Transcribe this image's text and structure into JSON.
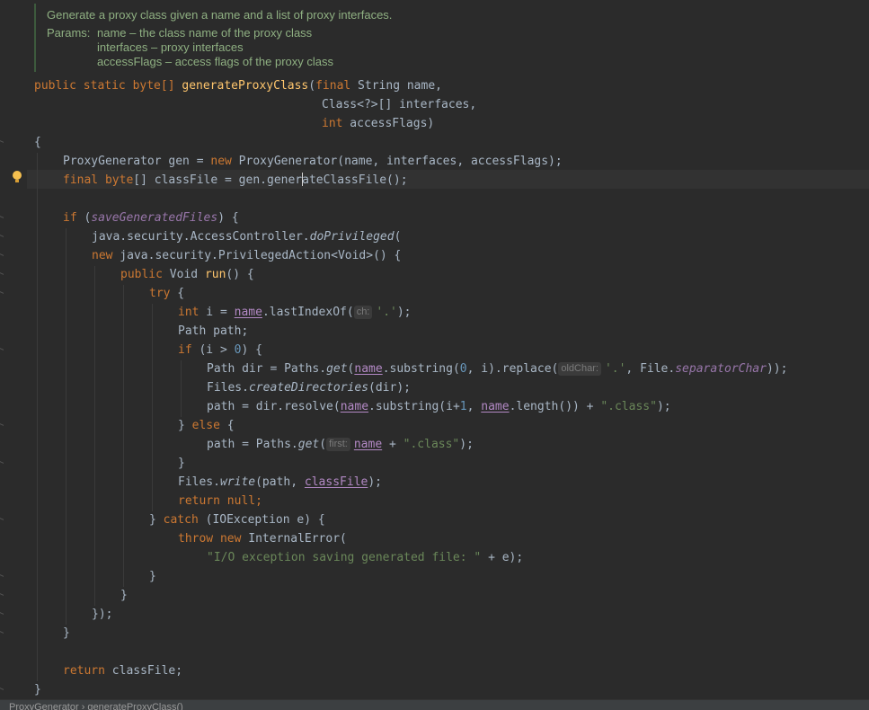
{
  "javadoc": {
    "summary": "Generate a proxy class given a name and a list of proxy interfaces.",
    "params_label": "Params:",
    "params": [
      "name – the class name of the proxy class",
      "interfaces – proxy interfaces",
      "accessFlags – access flags of the proxy class"
    ]
  },
  "code": {
    "sig_mods": "public static",
    "sig_type": "byte[]",
    "method_name": "generateProxyClass",
    "p_final": "final",
    "p1": " String name,",
    "p2": "Class<?>[] interfaces,",
    "p3_kw": "int",
    "p3": " accessFlags)",
    "open_brace": "{",
    "close_brace": "}",
    "gen_decl": "ProxyGenerator gen = ",
    "kw_new": "new",
    "gen_ctor": " ProxyGenerator(name, interfaces, accessFlags);",
    "final_kw": "final",
    "byte_kw": "byte",
    "cf_decl_a": "[] classFile = gen.gener",
    "cf_decl_b": "ateClassFile();",
    "if_kw": "if",
    "if_open": " (",
    "save_field": "saveGeneratedFiles",
    "if_close": ") {",
    "ac_call": "java.security.AccessController.",
    "do_priv": "doPrivileged",
    "paren_open": "(",
    "pa_new": "new",
    "pa_type": " java.security.PrivilegedAction<Void>() {",
    "run_public": "public",
    "run_type": " Void ",
    "run_name": "run",
    "run_tail": "() {",
    "try_kw": "try",
    "try_tail": " {",
    "int_kw": "int",
    "idx_a": " i = ",
    "name_var": "name",
    "idx_b": ".lastIndexOf(",
    "hint_ch": "ch:",
    "dot_char": "'.'",
    "semi_close": ");",
    "path_decl": "Path path;",
    "if2_a": " (i > ",
    "zero": "0",
    "if2_b": ") {",
    "dir_a": "Path dir = Paths.",
    "get_fn": "get",
    "dir_b": ".substring(",
    "comma_i": ", i).replace(",
    "hint_oldchar": "oldChar:",
    "dir_c": ", File.",
    "sep_char": "separatorChar",
    "dbl_close": "));",
    "files_pre": "Files.",
    "create_dirs": "createDirectories",
    "dir_arg": "(dir);",
    "res_a": "path = dir.resolve(",
    "res_b": ".substring(i+",
    "one": "1",
    "res_c": ", ",
    "res_d": ".length()) + ",
    "class_str": "\".class\"",
    "else_close": "} ",
    "else_kw": "else",
    "else_tail": " {",
    "pg_a": "path = Paths.",
    "hint_first": "first:",
    "plus": " + ",
    "write_fn": "write",
    "write_a": "(path, ",
    "class_file": "classFile",
    "return_kw": "return",
    "null_kw": "null",
    "semicolon": ";",
    "catch_close": "} ",
    "catch_kw": "catch",
    "catch_tail": " (IOException e) {",
    "throw_kw": "throw",
    "ie_tail": " InternalError(",
    "err_str": "\"I/O exception saving generated file: \"",
    "err_tail": " + e);",
    "anon_close": "});",
    "ret_tail": " classFile;"
  },
  "breadcrumb": "ProxyGenerator  ›  generateProxyClass()"
}
